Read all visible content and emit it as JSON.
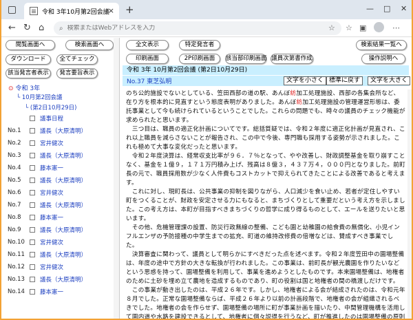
{
  "browser": {
    "tab_title": "令和 3年10月第2回会議（第1日",
    "tab_close": "×",
    "new_tab": "+",
    "address_placeholder": "検索またはWebアドレスを入力",
    "window_controls": [
      "—",
      "□",
      "✕"
    ]
  },
  "left_buttons": {
    "close_view": "閲覧画面へ",
    "search_view": "検索画面へ",
    "download": "ダウンロード",
    "check_all": "全てチェック",
    "show_speakers": "該当発言者表示",
    "show_speech_summary": "発言要旨表示"
  },
  "tree": {
    "root": "令和 3年",
    "session": "10月第2回会議",
    "day": "(第2日10月29日)",
    "items": [
      {
        "no": "",
        "name": "議事日程"
      },
      {
        "no": "No.1",
        "name": "議長（大原清明）"
      },
      {
        "no": "No.2",
        "name": "宮井健次"
      },
      {
        "no": "No.3",
        "name": "議長（大原清明）"
      },
      {
        "no": "No.4",
        "name": "藤本憲一"
      },
      {
        "no": "No.5",
        "name": "議長（大原清明）"
      },
      {
        "no": "No.6",
        "name": "宮井健次"
      },
      {
        "no": "No.7",
        "name": "議長（大原清明）"
      },
      {
        "no": "No.8",
        "name": "藤本憲一"
      },
      {
        "no": "No.9",
        "name": "議長（大原清明）"
      },
      {
        "no": "No.10",
        "name": "宮井健次"
      },
      {
        "no": "No.11",
        "name": "議長（大原清明）"
      },
      {
        "no": "No.12",
        "name": "宮井健次"
      },
      {
        "no": "No.13",
        "name": "議長（大原清明）"
      },
      {
        "no": "No.14",
        "name": "藤本憲一"
      }
    ]
  },
  "right_buttons": {
    "show_all": "全文表示",
    "specific_speaker": "特定発言者",
    "search_results": "検索結果一覧へ",
    "print_view": "印刷画面",
    "two_page_print": "2P印刷画面",
    "speaker_print": "該当部印刷画面",
    "member_list": "議員次第書作成",
    "help": "操作説明へ"
  },
  "content": {
    "meeting_title": "令和 3年 10月第2回会議 (第2日10月29日)",
    "speaker": "No.37 東芝弘明",
    "font_smaller": "文字を小さく",
    "font_standard": "標準に戻す",
    "font_larger": "文字を大きく",
    "paragraphs": [
      {
        "pre": "のち公的施設でないとしている、笠田西部の道の駅、あんぼ",
        "hl": "紡",
        "post": "加工処理施設、西部の各集会所など、在り方を根本的に見直すという態度表明がありました。あんぼ"
      },
      {
        "pre": "",
        "hl": "紡",
        "post": "加工処理施設の管理運営形態は、委託事業として今も続けられているということでした。これらの問題でも、時々の議員のチェック機能が求められたと思います。"
      },
      {
        "pre": "　三つ目は、職員の適正化計画についてです。総括質疑では、令和２年度に適正化計画が見直され、これ以上職員を減らさないことが報告され、この中で今後、専門職も採用する姿勢が示されました。これも極めて大事な変化だったと思います。",
        "hl": "",
        "post": ""
      },
      {
        "pre": "　令和２年度決算は、経常収支比率が９６．７％となって、やや改善し、財政調整基金を取り崩すことなく、基金を１億９，１７１万円積み上げ、残高は８億３，４３７万４，０００円となりました。前町長の元で、職員採用数が少なく人件費もコストカットで抑えられてきたことによる改善であると考えます。",
        "hl": "",
        "post": ""
      },
      {
        "pre": "　これに対し、現町長は、公共事業の抑制を図りながら、人口減少を食い止め、若者が定住しやすい町をつくることが、財政を安定させる力にもなると、まちづくりとして重要だという考え方を示しました。この考え方は、本町が目指すべきまちづくりの哲学に成り得るものとして、エールを送りたいと思います。",
        "hl": "",
        "post": ""
      },
      {
        "pre": "　その他、危機管理課の設置、防災行政無線の整備、こども園と幼稚園の給食費の無償化、小児インフルエンザの予防接種の中学生までの拡充、町道の維持改修費の倍増などは、賛成すべき事業でした。",
        "hl": "",
        "post": ""
      },
      {
        "pre": "　決算審査に関わって、議員として明らかにすべきだった点を述べます。令和２年度笠田中の園場整備は、年度の途中で方針の大きな転換が行われました。この事業は、前町長が観光農園を作りたいなどという思惑を持って、園場整備を利用して、事業を進めようとしたものです。本来園場整備は、地権者のために土砂を埋め立て農地を造成するものであり、町の役割は国と地権者の間の橋渡しだけです。",
        "hl": "",
        "post": ""
      },
      {
        "pre": "　この事業が動き出したのは、平成２６年です。しかし、地権者による会が結成されたのは、令和元年８月でした。正常な園場整備ならば、平成２６年より以前の計画段階で、地権者の会が組織されるべきでした。地権者の会を作らせず、園場整備の場所に町が事業計画を描いたり、中間管理機構を活用して園内道や水路を建設できるとして、地権者に個々説得を行うなど、町が推進したのは園場整備の原則をことごとく踏みにじるものでした。",
        "hl": "",
        "post": ""
      }
    ]
  }
}
